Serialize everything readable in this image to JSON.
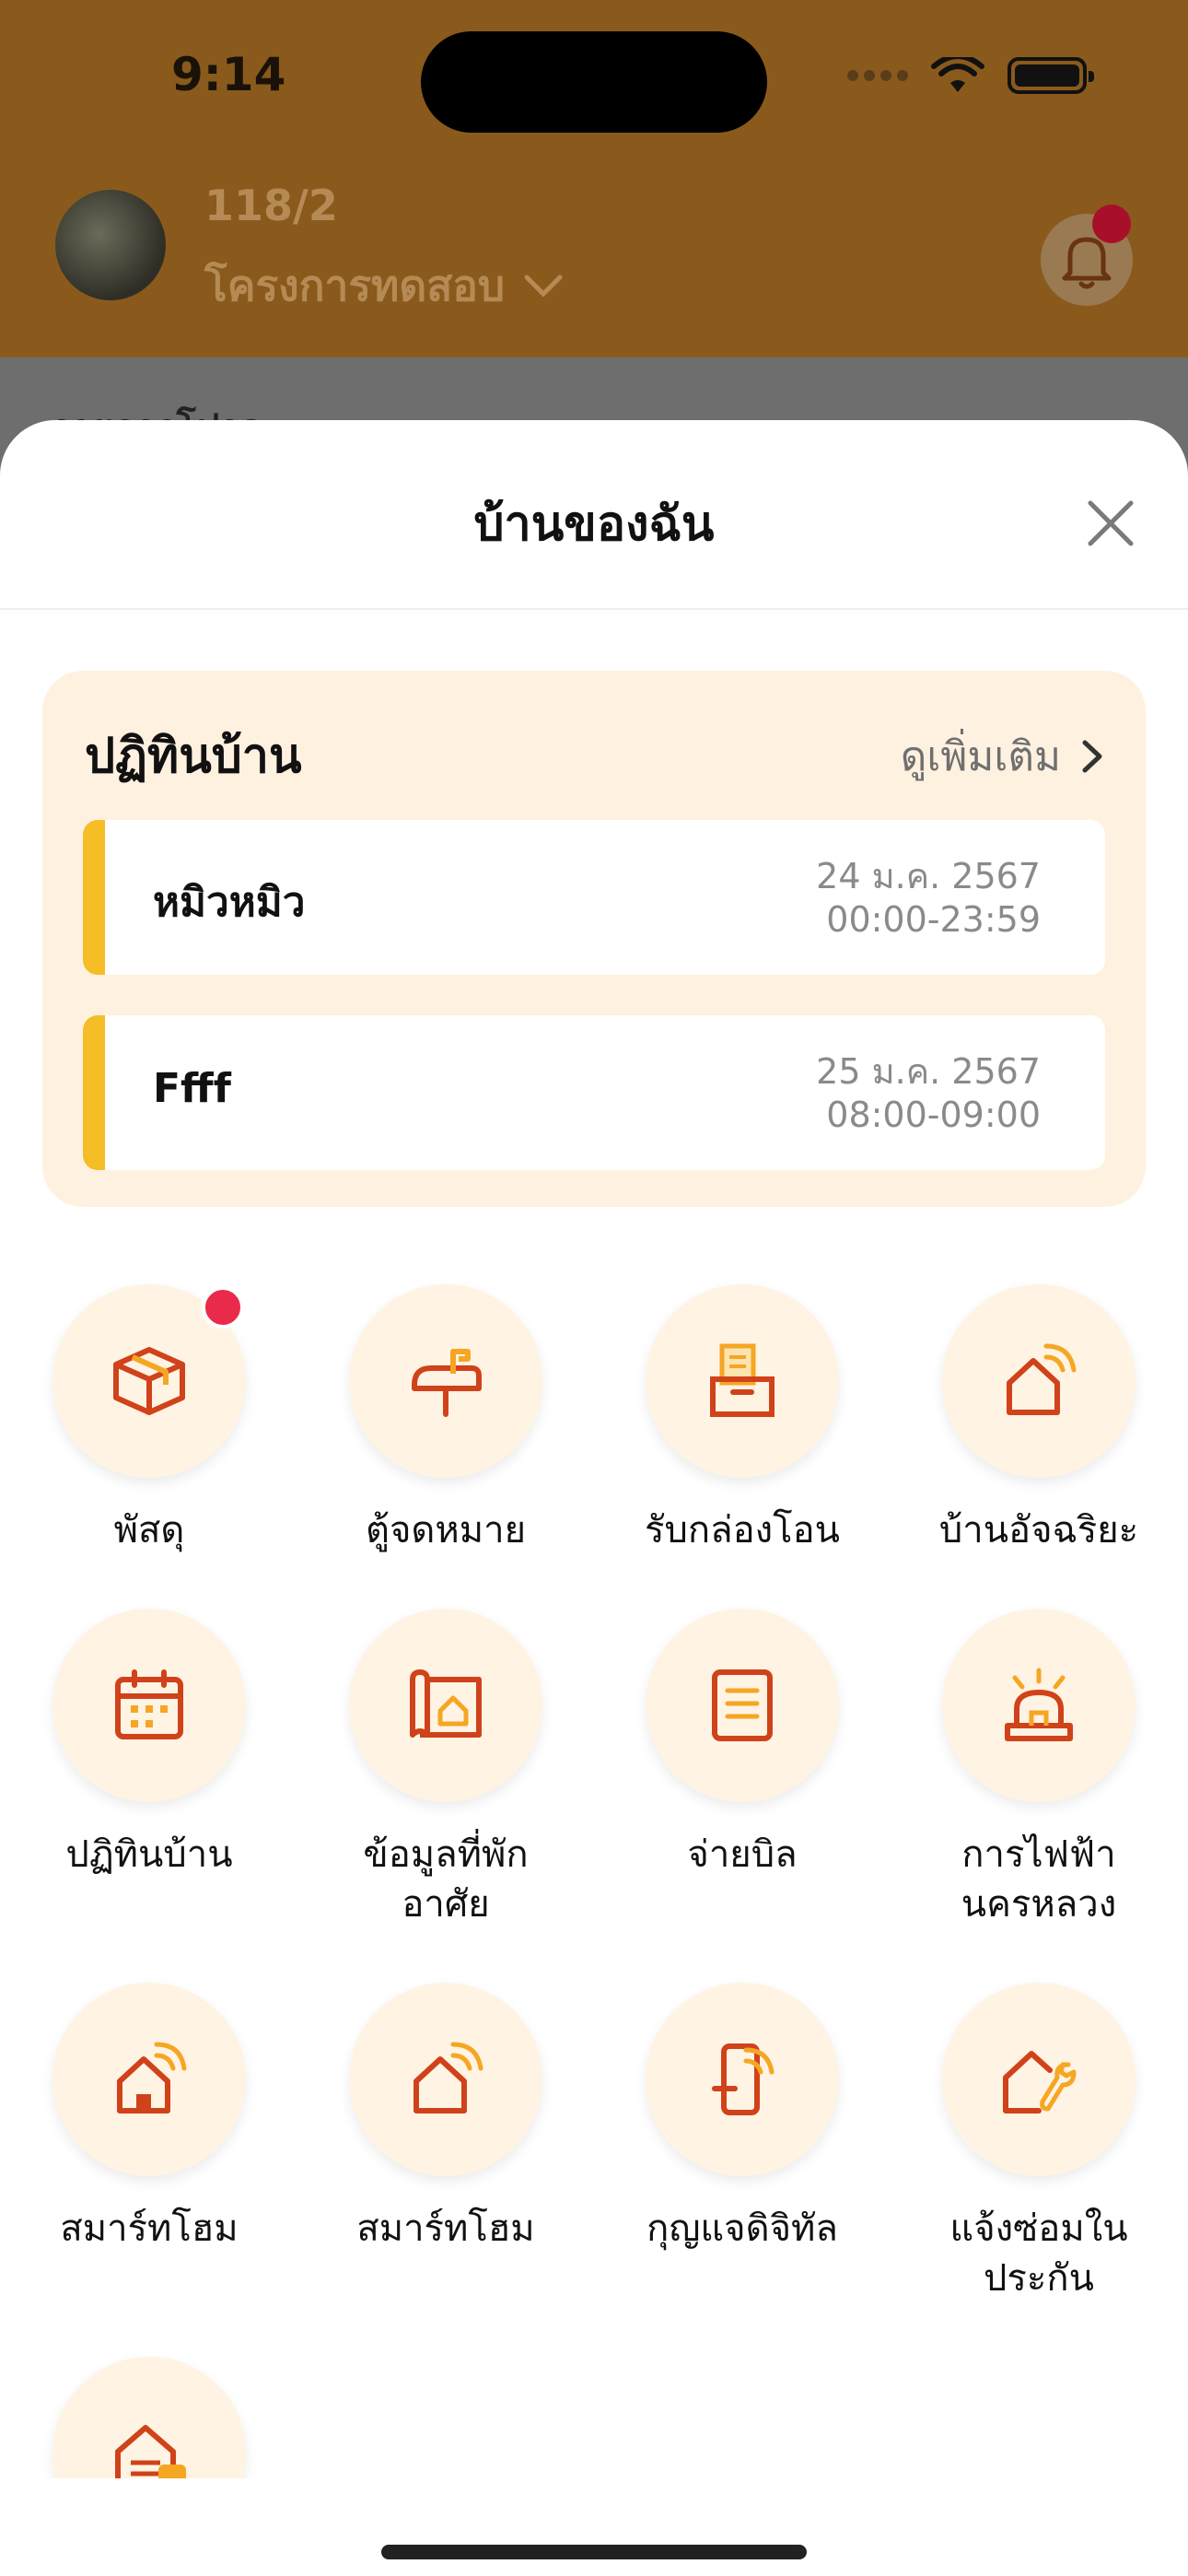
{
  "status_bar": {
    "time": "9:14"
  },
  "background": {
    "unit_no": "118/2",
    "project_name": "โครงการทดสอบ",
    "peek_text": "รายการโปรด"
  },
  "sheet": {
    "title": "บ้านของฉัน",
    "calendar": {
      "title": "ปฏิทินบ้าน",
      "more_label": "ดูเพิ่มเติม",
      "events": [
        {
          "name": "หมิวหมิว",
          "date": "24 ม.ค. 2567",
          "time": "00:00-23:59"
        },
        {
          "name": "Ffff",
          "date": "25 ม.ค. 2567",
          "time": "08:00-09:00"
        }
      ]
    },
    "menu": [
      {
        "label": "พัสดุ",
        "icon": "parcel-icon",
        "badge": true
      },
      {
        "label": "ตู้จดหมาย",
        "icon": "mailbox-icon"
      },
      {
        "label": "รับกล่องโอน",
        "icon": "transfer-box-icon"
      },
      {
        "label": "บ้านอัจฉริยะ",
        "icon": "smart-home-icon"
      },
      {
        "label": "ปฏิทินบ้าน",
        "icon": "calendar-icon"
      },
      {
        "label": "ข้อมูลที่พัก\nอาศัย",
        "icon": "residence-info-icon"
      },
      {
        "label": "จ่ายบิล",
        "icon": "bill-icon"
      },
      {
        "label": "การไฟฟ้า\nนครหลวง",
        "icon": "electricity-icon"
      },
      {
        "label": "สมาร์ทโฮม",
        "icon": "smart-home-icon"
      },
      {
        "label": "สมาร์ทโฮม",
        "icon": "smart-home-icon"
      },
      {
        "label": "กุญแจดิจิทัล",
        "icon": "digital-key-icon"
      },
      {
        "label": "แจ้งซ่อมใน\nประกัน",
        "icon": "warranty-repair-icon"
      },
      {
        "label": "",
        "icon": "home-payment-icon"
      }
    ]
  },
  "colors": {
    "accent": "#d0421a",
    "accent_light": "#f5a623",
    "card_bg": "#fff1e0",
    "event_bar": "#f5bd26",
    "badge": "#ea2a4a"
  }
}
